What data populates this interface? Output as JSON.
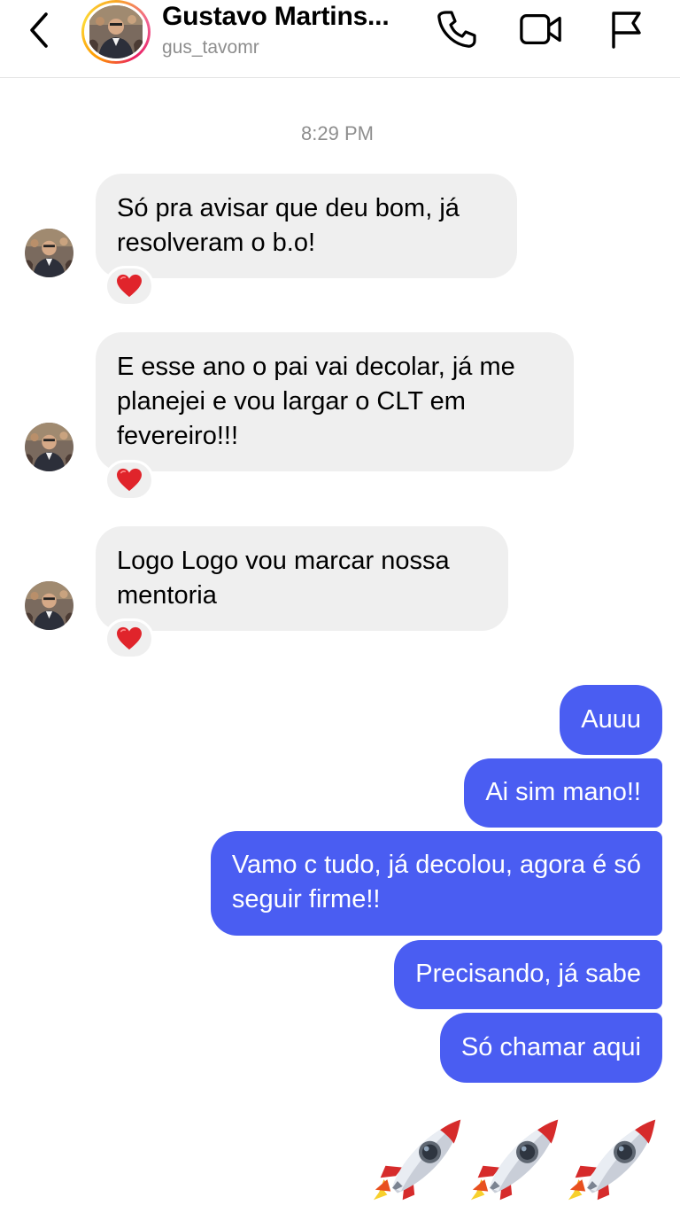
{
  "header": {
    "name": "Gustavo Martins...",
    "username": "gus_tavomr"
  },
  "conversation": {
    "timestamp": "8:29 PM",
    "incoming": [
      {
        "lines": [
          "Só pra avisar que deu bom, já",
          "resolveram o b.o!"
        ],
        "reaction": "heart"
      },
      {
        "lines": [
          "E esse ano o pai vai decolar, já me",
          "planejei e vou largar o CLT em",
          "fevereiro!!!"
        ],
        "reaction": "heart"
      },
      {
        "lines": [
          "Logo Logo vou marcar nossa",
          "mentoria"
        ],
        "reaction": "heart"
      }
    ],
    "outgoing": [
      {
        "lines": [
          "Auuu"
        ]
      },
      {
        "lines": [
          "Ai sim mano!!"
        ]
      },
      {
        "lines": [
          "Vamo c tudo, já decolou, agora é só",
          "seguir firme!!"
        ]
      },
      {
        "lines": [
          "Precisando, já sabe"
        ]
      },
      {
        "lines": [
          "Só chamar aqui"
        ]
      }
    ],
    "emoji_message": [
      "rocket-emoji",
      "rocket-emoji",
      "rocket-emoji"
    ]
  },
  "colors": {
    "outgoing_bubble": "#4a5df2",
    "incoming_bubble": "#efefef",
    "heart": "#e0242b"
  }
}
